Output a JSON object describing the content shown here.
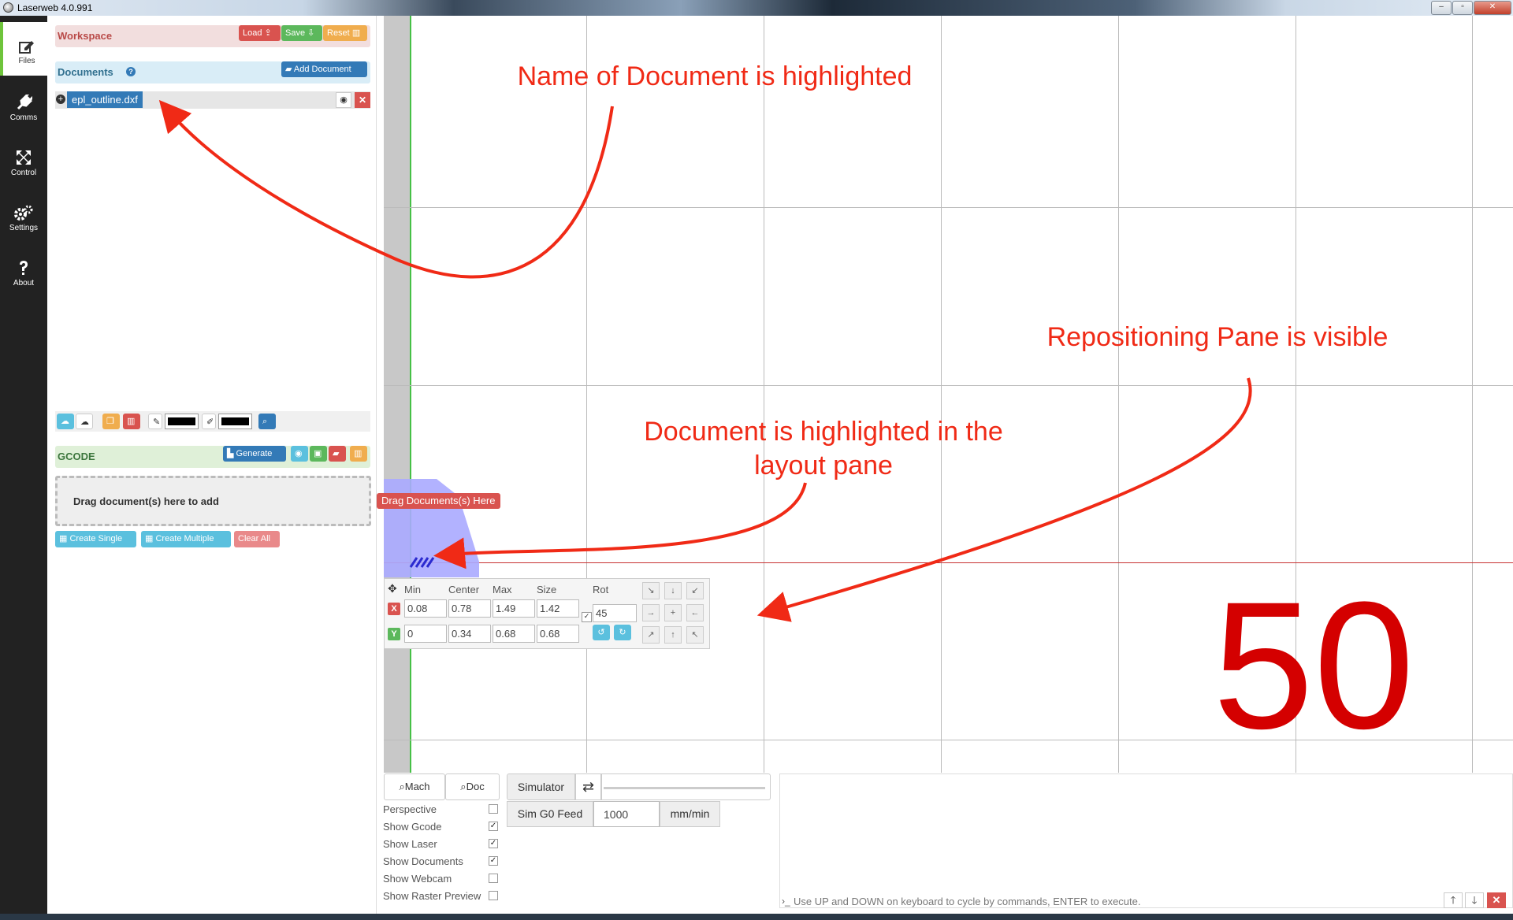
{
  "window": {
    "title": "Laserweb 4.0.991",
    "min": "–",
    "max": "▫",
    "close": "✕"
  },
  "nav": [
    {
      "label": "Files",
      "icon": "edit-icon"
    },
    {
      "label": "Comms",
      "icon": "plug-icon"
    },
    {
      "label": "Control",
      "icon": "arrows-icon"
    },
    {
      "label": "Settings",
      "icon": "gears-icon"
    },
    {
      "label": "About",
      "icon": "question-icon"
    }
  ],
  "workspace": {
    "title": "Workspace",
    "load": "Load",
    "save": "Save",
    "reset": "Reset"
  },
  "documents": {
    "title": "Documents",
    "help": "?",
    "add": "Add Document",
    "items": [
      {
        "name": "epl_outline.dxf"
      }
    ]
  },
  "gcode": {
    "title": "GCODE",
    "generate": "Generate",
    "drop_hint": "Drag document(s) here to add",
    "drop_tag": "Drag Documents(s) Here",
    "create_single": "Create Single",
    "create_multiple": "Create Multiple",
    "clear_all": "Clear All"
  },
  "colors": {
    "accent_green": "#6ec43b",
    "annotation": "#f02a16",
    "big_number": "#d40000"
  },
  "annotations": {
    "name_highlight": "Name of Document is highlighted",
    "repositioning": "Repositioning Pane is visible",
    "layout_line1": "Document is highlighted in the",
    "layout_line2": "layout pane"
  },
  "canvas": {
    "big_label": "50"
  },
  "repos": {
    "headers": {
      "min": "Min",
      "center": "Center",
      "max": "Max",
      "size": "Size",
      "rot": "Rot"
    },
    "x": {
      "label": "X",
      "min": "0.08",
      "center": "0.78",
      "max": "1.49",
      "size": "1.42"
    },
    "y": {
      "label": "Y",
      "min": "0",
      "center": "0.34",
      "max": "0.68",
      "size": "0.68"
    },
    "rot": "45",
    "arrows": [
      "↘",
      "↓",
      "↙",
      "→",
      "+",
      "←",
      "↗",
      "↑",
      "↖"
    ]
  },
  "view": {
    "mach": "Mach",
    "doc": "Doc"
  },
  "options": [
    {
      "label": "Perspective",
      "checked": false
    },
    {
      "label": "Show Gcode",
      "checked": true
    },
    {
      "label": "Show Laser",
      "checked": true
    },
    {
      "label": "Show Documents",
      "checked": true
    },
    {
      "label": "Show Webcam",
      "checked": false
    },
    {
      "label": "Show Raster Preview",
      "checked": false
    }
  ],
  "simulator": {
    "label": "Simulator",
    "feed_label": "Sim G0 Feed",
    "feed_value": "1000",
    "unit": "mm/min"
  },
  "console": {
    "hint": "Use UP and DOWN on keyboard to cycle by commands, ENTER to execute."
  }
}
